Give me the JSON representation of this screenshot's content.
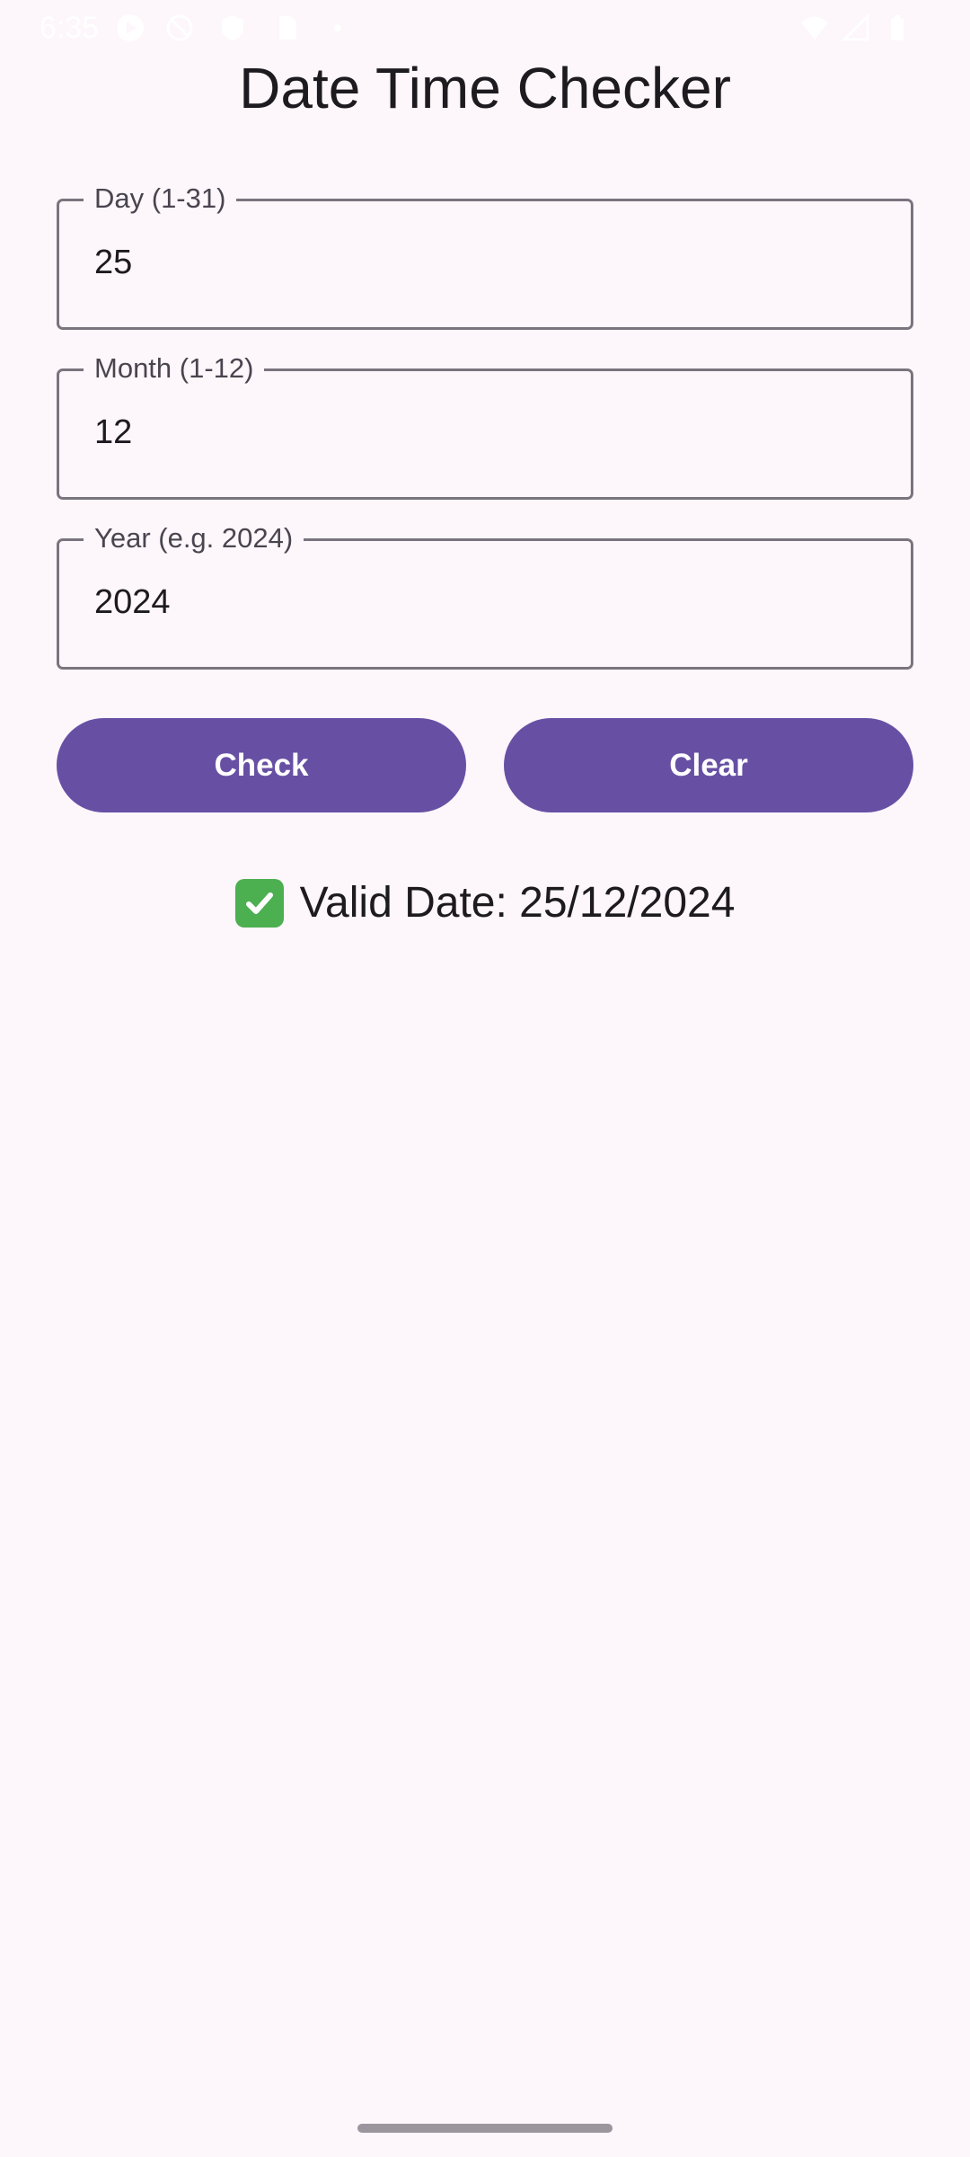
{
  "status_bar": {
    "time": "6:35",
    "icons": [
      "media-icon",
      "sync-icon",
      "shield-icon",
      "sim-card-icon",
      "dot-icon",
      "wifi-icon",
      "cell-signal-icon",
      "battery-icon"
    ]
  },
  "app": {
    "title": "Date Time Checker"
  },
  "fields": {
    "day": {
      "label": "Day (1-31)",
      "value": "25"
    },
    "month": {
      "label": "Month (1-12)",
      "value": "12"
    },
    "year": {
      "label": "Year (e.g. 2024)",
      "value": "2024"
    }
  },
  "buttons": {
    "check": "Check",
    "clear": "Clear"
  },
  "result": {
    "icon": "check-mark-icon",
    "text": "Valid Date: 25/12/2024"
  },
  "colors": {
    "background": "#fdf6fb",
    "primary": "#6750a4",
    "outline": "#79747e",
    "success": "#4caf50"
  }
}
